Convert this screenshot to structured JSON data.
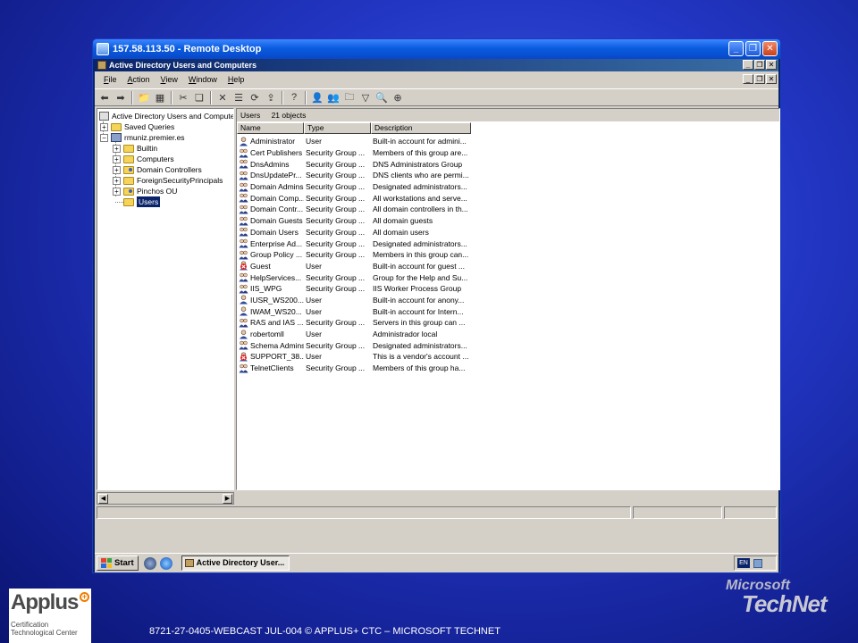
{
  "remote_desktop": {
    "title": "157.58.113.50 - Remote Desktop"
  },
  "mmc": {
    "title": "Active Directory Users and Computers",
    "menu": [
      "File",
      "Action",
      "View",
      "Window",
      "Help"
    ]
  },
  "tree": {
    "root": "Active Directory Users and Computers",
    "saved_queries": "Saved Queries",
    "domain": "rmuniz.premier.es",
    "children": [
      "Builtin",
      "Computers",
      "Domain Controllers",
      "ForeignSecurityPrincipals",
      "Pinchos OU",
      "Users"
    ]
  },
  "list": {
    "container": "Users",
    "count": "21 objects",
    "columns": [
      "Name",
      "Type",
      "Description"
    ],
    "rows": [
      {
        "name": "Administrator",
        "type": "User",
        "desc": "Built-in account for admini...",
        "icon": "user-icon"
      },
      {
        "name": "Cert Publishers",
        "type": "Security Group ...",
        "desc": "Members of this group are...",
        "icon": "group-icon"
      },
      {
        "name": "DnsAdmins",
        "type": "Security Group ...",
        "desc": "DNS Administrators Group",
        "icon": "group-icon"
      },
      {
        "name": "DnsUpdatePr...",
        "type": "Security Group ...",
        "desc": "DNS clients who are permi...",
        "icon": "group-icon"
      },
      {
        "name": "Domain Admins",
        "type": "Security Group ...",
        "desc": "Designated administrators...",
        "icon": "group-icon"
      },
      {
        "name": "Domain Comp...",
        "type": "Security Group ...",
        "desc": "All workstations and serve...",
        "icon": "group-icon"
      },
      {
        "name": "Domain Contr...",
        "type": "Security Group ...",
        "desc": "All domain controllers in th...",
        "icon": "group-icon"
      },
      {
        "name": "Domain Guests",
        "type": "Security Group ...",
        "desc": "All domain guests",
        "icon": "group-icon"
      },
      {
        "name": "Domain Users",
        "type": "Security Group ...",
        "desc": "All domain users",
        "icon": "group-icon"
      },
      {
        "name": "Enterprise Ad...",
        "type": "Security Group ...",
        "desc": "Designated administrators...",
        "icon": "group-icon"
      },
      {
        "name": "Group Policy ...",
        "type": "Security Group ...",
        "desc": "Members in this group can...",
        "icon": "group-icon"
      },
      {
        "name": "Guest",
        "type": "User",
        "desc": "Built-in account for guest ...",
        "icon": "disabled-user-icon"
      },
      {
        "name": "HelpServices...",
        "type": "Security Group ...",
        "desc": "Group for the Help and Su...",
        "icon": "group-icon"
      },
      {
        "name": "IIS_WPG",
        "type": "Security Group ...",
        "desc": "IIS Worker Process Group",
        "icon": "group-icon"
      },
      {
        "name": "IUSR_WS200...",
        "type": "User",
        "desc": "Built-in account for anony...",
        "icon": "user-icon"
      },
      {
        "name": "IWAM_WS20...",
        "type": "User",
        "desc": "Built-in account for Intern...",
        "icon": "user-icon"
      },
      {
        "name": "RAS and IAS ...",
        "type": "Security Group ...",
        "desc": "Servers in this group can ...",
        "icon": "group-icon"
      },
      {
        "name": "robertomll",
        "type": "User",
        "desc": "Administrador local",
        "icon": "user-icon"
      },
      {
        "name": "Schema Admins",
        "type": "Security Group ...",
        "desc": "Designated administrators...",
        "icon": "group-icon"
      },
      {
        "name": "SUPPORT_38...",
        "type": "User",
        "desc": "This is a vendor's account ...",
        "icon": "disabled-user-icon"
      },
      {
        "name": "TelnetClients",
        "type": "Security Group ...",
        "desc": "Members of this group ha...",
        "icon": "group-icon"
      }
    ]
  },
  "taskbar": {
    "start_label": "Start",
    "task_button": "Active Directory User...",
    "language": "EN"
  },
  "footer": {
    "logo_main": "Applus",
    "logo_sub": "Certification Technological Center",
    "caption": "8721-27-0405-WEBCAST  JUL-004      © APPLUS+ CTC – MICROSOFT  TECHNET",
    "microsoft": "Microsoft",
    "technet": "TechNet"
  }
}
